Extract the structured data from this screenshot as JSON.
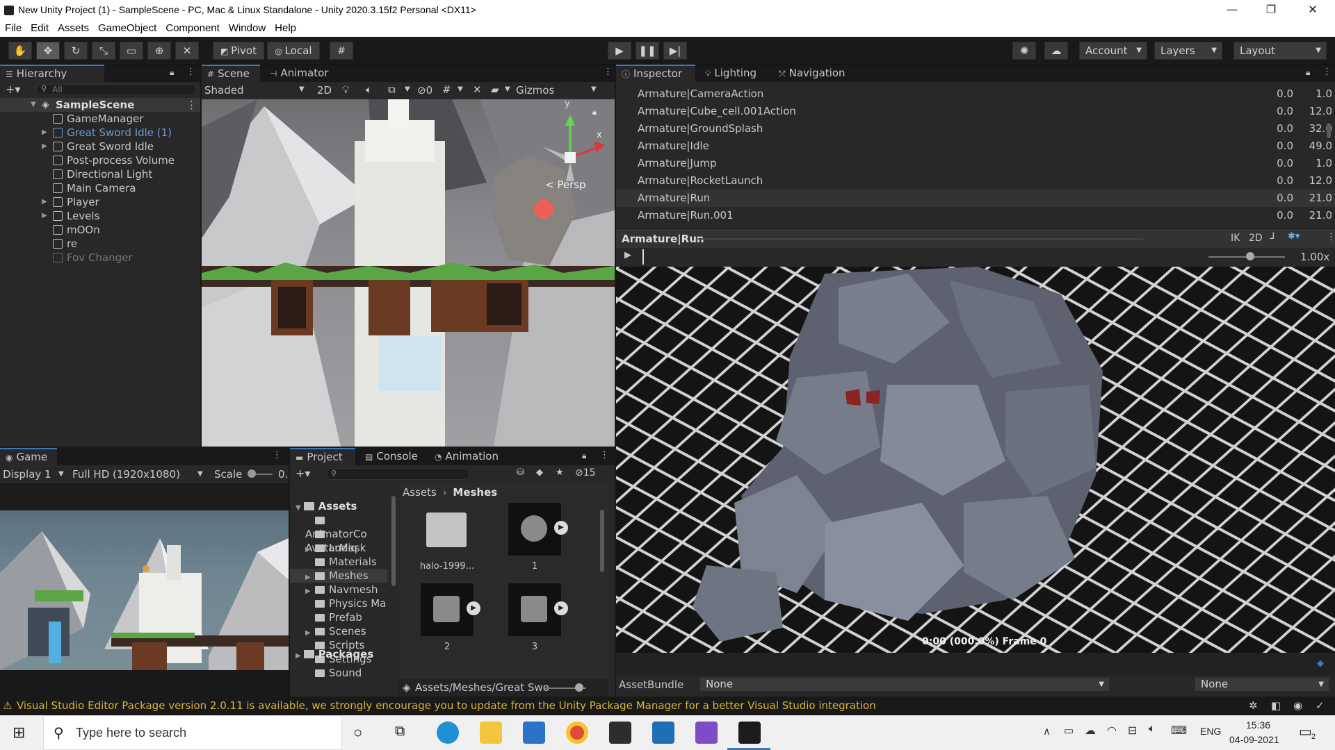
{
  "window": {
    "title": "New Unity Project (1) - SampleScene - PC, Mac & Linux Standalone - Unity 2020.3.15f2 Personal <DX11>",
    "controls": [
      "—",
      "❐",
      "✕"
    ]
  },
  "menu": [
    "File",
    "Edit",
    "Assets",
    "GameObject",
    "Component",
    "Window",
    "Help"
  ],
  "toolbar": {
    "pivot": "Pivot",
    "local": "Local",
    "account": "Account",
    "layers": "Layers",
    "layout": "Layout"
  },
  "hierarchy": {
    "tab": "Hierarchy",
    "search_placeholder": "All",
    "scene": "SampleScene",
    "items": [
      {
        "label": "GameManager",
        "expandable": false,
        "state": "normal"
      },
      {
        "label": "Great Sword Idle (1)",
        "expandable": true,
        "state": "prefab-missing"
      },
      {
        "label": "Great Sword Idle",
        "expandable": true,
        "state": "normal"
      },
      {
        "label": "Post-process Volume",
        "expandable": false,
        "state": "normal"
      },
      {
        "label": "Directional Light",
        "expandable": false,
        "state": "normal"
      },
      {
        "label": "Main Camera",
        "expandable": false,
        "state": "normal"
      },
      {
        "label": "Player",
        "expandable": true,
        "state": "normal"
      },
      {
        "label": "Levels",
        "expandable": true,
        "state": "normal"
      },
      {
        "label": "mOOn",
        "expandable": false,
        "state": "normal"
      },
      {
        "label": "re",
        "expandable": false,
        "state": "normal"
      },
      {
        "label": "Fov Changer",
        "expandable": false,
        "state": "disabled"
      }
    ]
  },
  "scene": {
    "tabs": [
      "Scene",
      "Animator"
    ],
    "shading": "Shaded",
    "mode_2d": "2D",
    "hidden_count": "0",
    "gizmos": "Gizmos",
    "persp": "< Persp",
    "axis_x": "x",
    "axis_y": "y"
  },
  "game": {
    "tab": "Game",
    "display": "Display 1",
    "resolution": "Full HD (1920x1080)",
    "scale_label": "Scale",
    "scale_value": "0."
  },
  "project": {
    "tabs": [
      "Project",
      "Console",
      "Animation"
    ],
    "hidden_count": "15",
    "tree_root": "Assets",
    "tree": [
      {
        "label": "AnimatorCo",
        "expandable": false
      },
      {
        "label": "AvatarMask",
        "expandable": false
      },
      {
        "label": "Ludiq",
        "expandable": true
      },
      {
        "label": "Materials",
        "expandable": false
      },
      {
        "label": "Meshes",
        "expandable": true,
        "selected": true
      },
      {
        "label": "Navmesh",
        "expandable": true
      },
      {
        "label": "Physics Ma",
        "expandable": false
      },
      {
        "label": "Prefab",
        "expandable": false
      },
      {
        "label": "Scenes",
        "expandable": true
      },
      {
        "label": "Scripts",
        "expandable": false
      },
      {
        "label": "Settings",
        "expandable": false
      },
      {
        "label": "Sound",
        "expandable": false
      }
    ],
    "packages": "Packages",
    "breadcrumb": [
      "Assets",
      "Meshes"
    ],
    "grid": [
      {
        "label": "halo-1999...",
        "kind": "folder"
      },
      {
        "label": "1",
        "kind": "mesh"
      },
      {
        "label": "2",
        "kind": "mesh"
      },
      {
        "label": "3",
        "kind": "mesh"
      }
    ],
    "path": "Assets/Meshes/Great Swo"
  },
  "inspector": {
    "tabs": [
      "Inspector",
      "Lighting",
      "Navigation"
    ],
    "clips": [
      {
        "name": "Armature|CameraAction",
        "start": "0.0",
        "end": "1.0"
      },
      {
        "name": "Armature|Cube_cell.001Action",
        "start": "0.0",
        "end": "12.0"
      },
      {
        "name": "Armature|GroundSplash",
        "start": "0.0",
        "end": "32.0"
      },
      {
        "name": "Armature|Idle",
        "start": "0.0",
        "end": "49.0"
      },
      {
        "name": "Armature|Jump",
        "start": "0.0",
        "end": "1.0"
      },
      {
        "name": "Armature|RocketLaunch",
        "start": "0.0",
        "end": "12.0"
      },
      {
        "name": "Armature|Run",
        "start": "0.0",
        "end": "21.0",
        "selected": true
      },
      {
        "name": "Armature|Run.001",
        "start": "0.0",
        "end": "21.0"
      }
    ],
    "preview_title": "Armature|Run",
    "ik": "IK",
    "mode_2d": "2D",
    "speed": "1.00x",
    "frame_readout": "0:00 (000.0%) Frame 0",
    "assetbundle_label": "AssetBundle",
    "assetbundle_value": "None",
    "assetbundle_variant": "None"
  },
  "status": {
    "message": "Visual Studio Editor Package version 2.0.11 is available, we strongly encourage you to update from the Unity Package Manager for a better Visual Studio integration"
  },
  "taskbar": {
    "search_placeholder": "Type here to search",
    "language": "ENG",
    "time": "15:36",
    "date": "04-09-2021",
    "notif_count": "2"
  },
  "colors": {
    "accent": "#3a79bb",
    "selection": "#2c5d87",
    "warning": "#d9b534",
    "prefab_missing": "#6d9ad0"
  }
}
